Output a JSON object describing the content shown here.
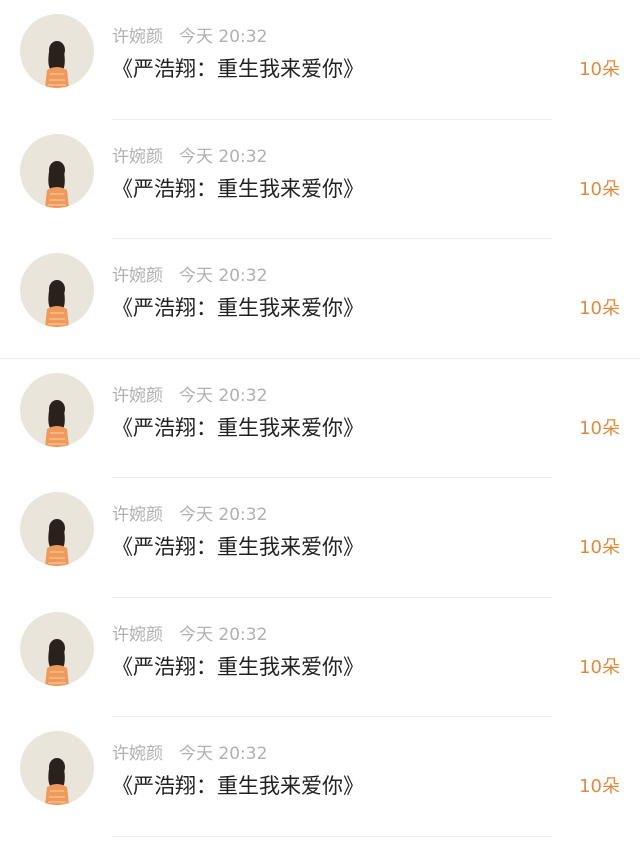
{
  "colors": {
    "background": "#ffffff",
    "meta_text": "#b0b0b0",
    "title_text": "#222222",
    "amount_text": "#e08a3f",
    "divider": "#efefef",
    "avatar_bg": "#e9e5da"
  },
  "avatar_icon": "girl-portrait-avatar",
  "messages": [
    {
      "sender": "许婉颜",
      "time": "今天 20:32",
      "title": "《严浩翔：重生我来爱你》",
      "amount": "10朵"
    },
    {
      "sender": "许婉颜",
      "time": "今天 20:32",
      "title": "《严浩翔：重生我来爱你》",
      "amount": "10朵"
    },
    {
      "sender": "许婉颜",
      "time": "今天 20:32",
      "title": "《严浩翔：重生我来爱你》",
      "amount": "10朵"
    },
    {
      "sender": "许婉颜",
      "time": "今天 20:32",
      "title": "《严浩翔：重生我来爱你》",
      "amount": "10朵"
    },
    {
      "sender": "许婉颜",
      "time": "今天 20:32",
      "title": "《严浩翔：重生我来爱你》",
      "amount": "10朵"
    },
    {
      "sender": "许婉颜",
      "time": "今天 20:32",
      "title": "《严浩翔：重生我来爱你》",
      "amount": "10朵"
    },
    {
      "sender": "许婉颜",
      "time": "今天 20:32",
      "title": "《严浩翔：重生我来爱你》",
      "amount": "10朵"
    }
  ]
}
